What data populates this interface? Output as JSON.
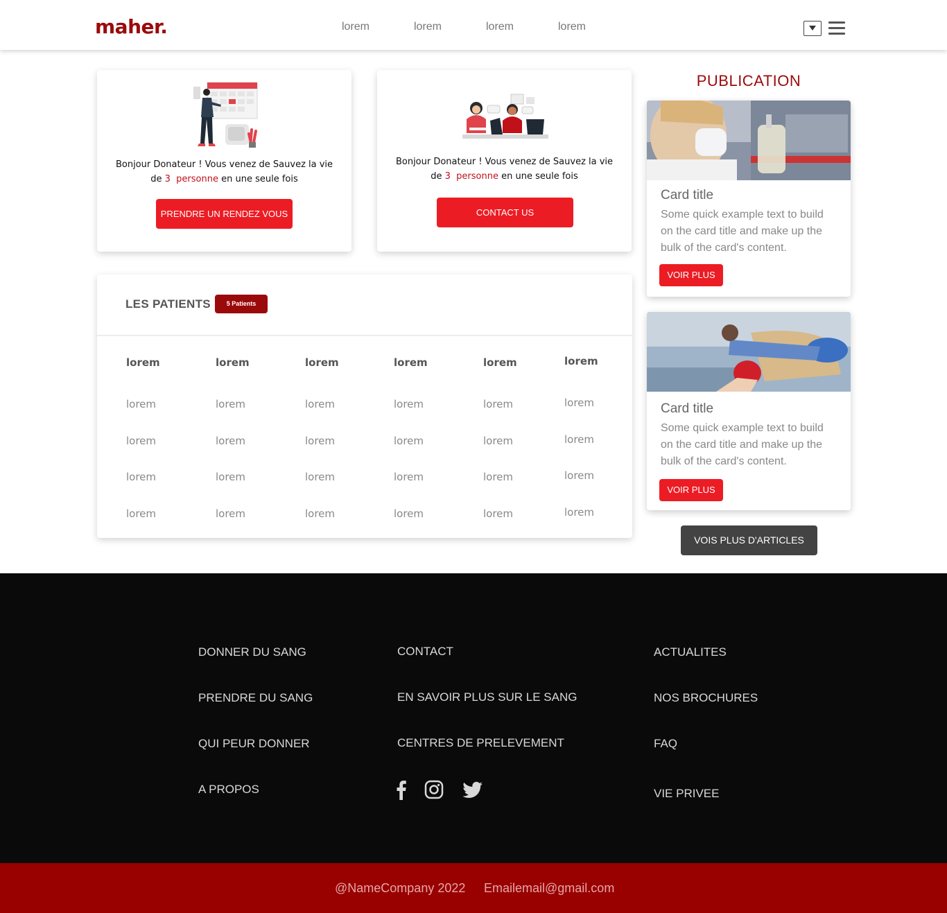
{
  "navbar": {
    "logo": "maher.",
    "links": [
      "lorem",
      "lorem",
      "lorem",
      "lorem"
    ]
  },
  "donor_cards": [
    {
      "line1": "Bonjour Donateur ! Vous venez de Sauvez la vie",
      "prefix": "de",
      "count": "3",
      "word": "personne",
      "suffix": "en une seule fois",
      "button": "PRENDRE UN RENDEZ VOUS"
    },
    {
      "line1": "Bonjour Donateur ! Vous venez de Sauvez la vie",
      "prefix": "de",
      "count": "3",
      "word": "personne",
      "suffix": "en une seule fois",
      "button": "CONTACT US"
    }
  ],
  "patients": {
    "title": "LES PATIENTS",
    "badge": "5 Patients",
    "headers": [
      "lorem",
      "lorem",
      "lorem",
      "lorem",
      "lorem",
      "lorem"
    ],
    "rows": [
      [
        "lorem",
        "lorem",
        "lorem",
        "lorem",
        "lorem",
        "lorem"
      ],
      [
        "lorem",
        "lorem",
        "lorem",
        "lorem",
        "lorem",
        "lorem"
      ],
      [
        "lorem",
        "lorem",
        "lorem",
        "lorem",
        "lorem",
        "lorem"
      ],
      [
        "lorem",
        "lorem",
        "lorem",
        "lorem",
        "lorem",
        "lorem"
      ]
    ]
  },
  "publication": {
    "title": "PUBLICATION",
    "cards": [
      {
        "title": "Card title",
        "text_lines": [
          "Some quick example text to build",
          "on the card title and make up the",
          "bulk of the card's content."
        ],
        "button": "VOIR PLUS"
      },
      {
        "title": "Card title",
        "text_lines": [
          "Some quick example text to build",
          "on the card title and make up the",
          "bulk of the card's content."
        ],
        "button": "VOIR PLUS"
      }
    ],
    "more_button": "VOIS PLUS D'ARTICLES"
  },
  "footer": {
    "col1": [
      "DONNER DU SANG",
      "PRENDRE DU SANG",
      "QUI PEUR DONNER",
      "A PROPOS"
    ],
    "col2": [
      "CONTACT",
      "EN SAVOIR PLUS SUR LE SANG",
      "CENTRES DE PRELEVEMENT"
    ],
    "col3": [
      "ACTUALITES",
      "NOS BROCHURES",
      "FAQ",
      "VIE PRIVEE"
    ],
    "social_icons": [
      "facebook-icon",
      "instagram-icon",
      "twitter-icon"
    ]
  },
  "bottom_bar": {
    "copyright": "@NameCompany 2022",
    "email": "Emailemail@gmail.com"
  },
  "colors": {
    "brand_red": "#9b0a0a",
    "button_red": "#ec1c24",
    "footer_bg": "#0a0a0a",
    "bottom_bar": "#990000"
  }
}
